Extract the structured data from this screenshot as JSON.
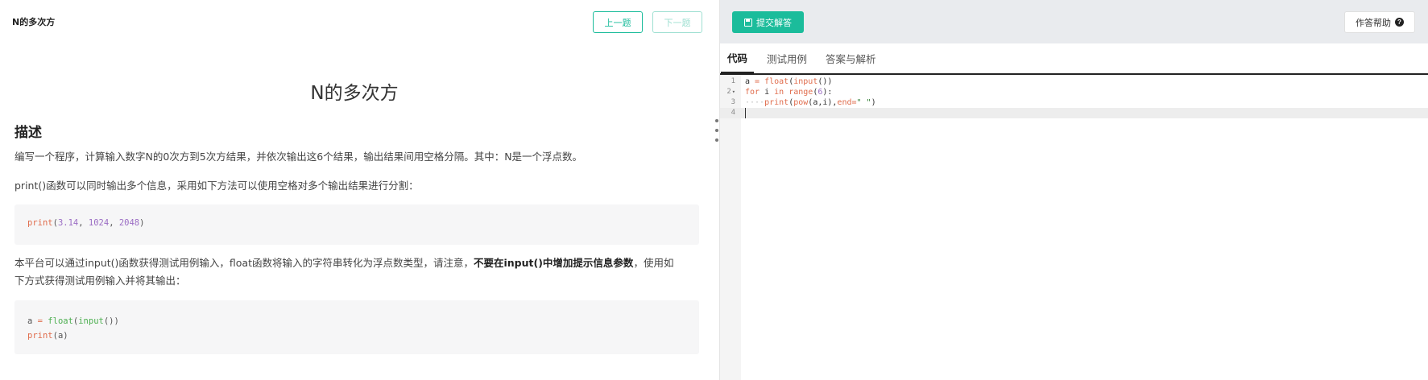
{
  "problem": {
    "topbar_title": "N的多次方",
    "prev_label": "上一题",
    "next_label": "下一题",
    "title": "N的多次方",
    "desc_heading": "描述",
    "para1": "编写一个程序，计算输入数字N的0次方到5次方结果，并依次输出这6个结果，输出结果间用空格分隔。其中：N是一个浮点数。",
    "para2": "print()函数可以同时输出多个信息，采用如下方法可以使用空格对多个输出结果进行分割：",
    "code1": {
      "fn": "print",
      "open": "(",
      "a": "3.14",
      "sep1": ", ",
      "b": "1024",
      "sep2": ", ",
      "c": "2048",
      "close": ")"
    },
    "para3_pre": "本平台可以通过input()函数获得测试用例输入，float函数将输入的字符串转化为浮点数类型，请注意，",
    "para3_bold": "不要在input()中增加提示信息参数",
    "para3_post": "，使用如下方式获得测试用例输入并将其输出：",
    "code2": {
      "l1_var": "a",
      "l1_eq": " = ",
      "l1_fn": "float",
      "l1_open": "(",
      "l1_fn2": "input",
      "l1_close": "())",
      "l2_fn": "print",
      "l2_open": "(",
      "l2_arg": "a",
      "l2_close": ")"
    }
  },
  "toolbar": {
    "submit_label": "提交解答",
    "help_label": "作答帮助",
    "help_icon": "?"
  },
  "tabs": [
    {
      "label": "代码"
    },
    {
      "label": "测试用例"
    },
    {
      "label": "答案与解析"
    }
  ],
  "editor": {
    "lines": [
      {
        "num": "1"
      },
      {
        "num": "2"
      },
      {
        "num": "3"
      },
      {
        "num": "4"
      }
    ],
    "fold_marker": "▾",
    "tokens": {
      "l1_var": "a",
      "l1_eq": " = ",
      "l1_float": "float",
      "l1_open": "(",
      "l1_input": "input",
      "l1_close": "())",
      "l2_for": "for",
      "l2_i": " i ",
      "l2_in": "in",
      "l2_sp": " ",
      "l2_range": "range",
      "l2_open": "(",
      "l2_num": "6",
      "l2_close": "):",
      "l3_indent": "····",
      "l3_print": "print",
      "l3_open": "(",
      "l3_pow": "pow",
      "l3_args": "(a,i),",
      "l3_end": "end",
      "l3_eq": "=",
      "l3_str": "\" \"",
      "l3_close": ")"
    }
  },
  "colors": {
    "accent": "#1bbc9b",
    "accent_disabled": "#9fe0d2",
    "toolbar_bg": "#e9ebee"
  }
}
